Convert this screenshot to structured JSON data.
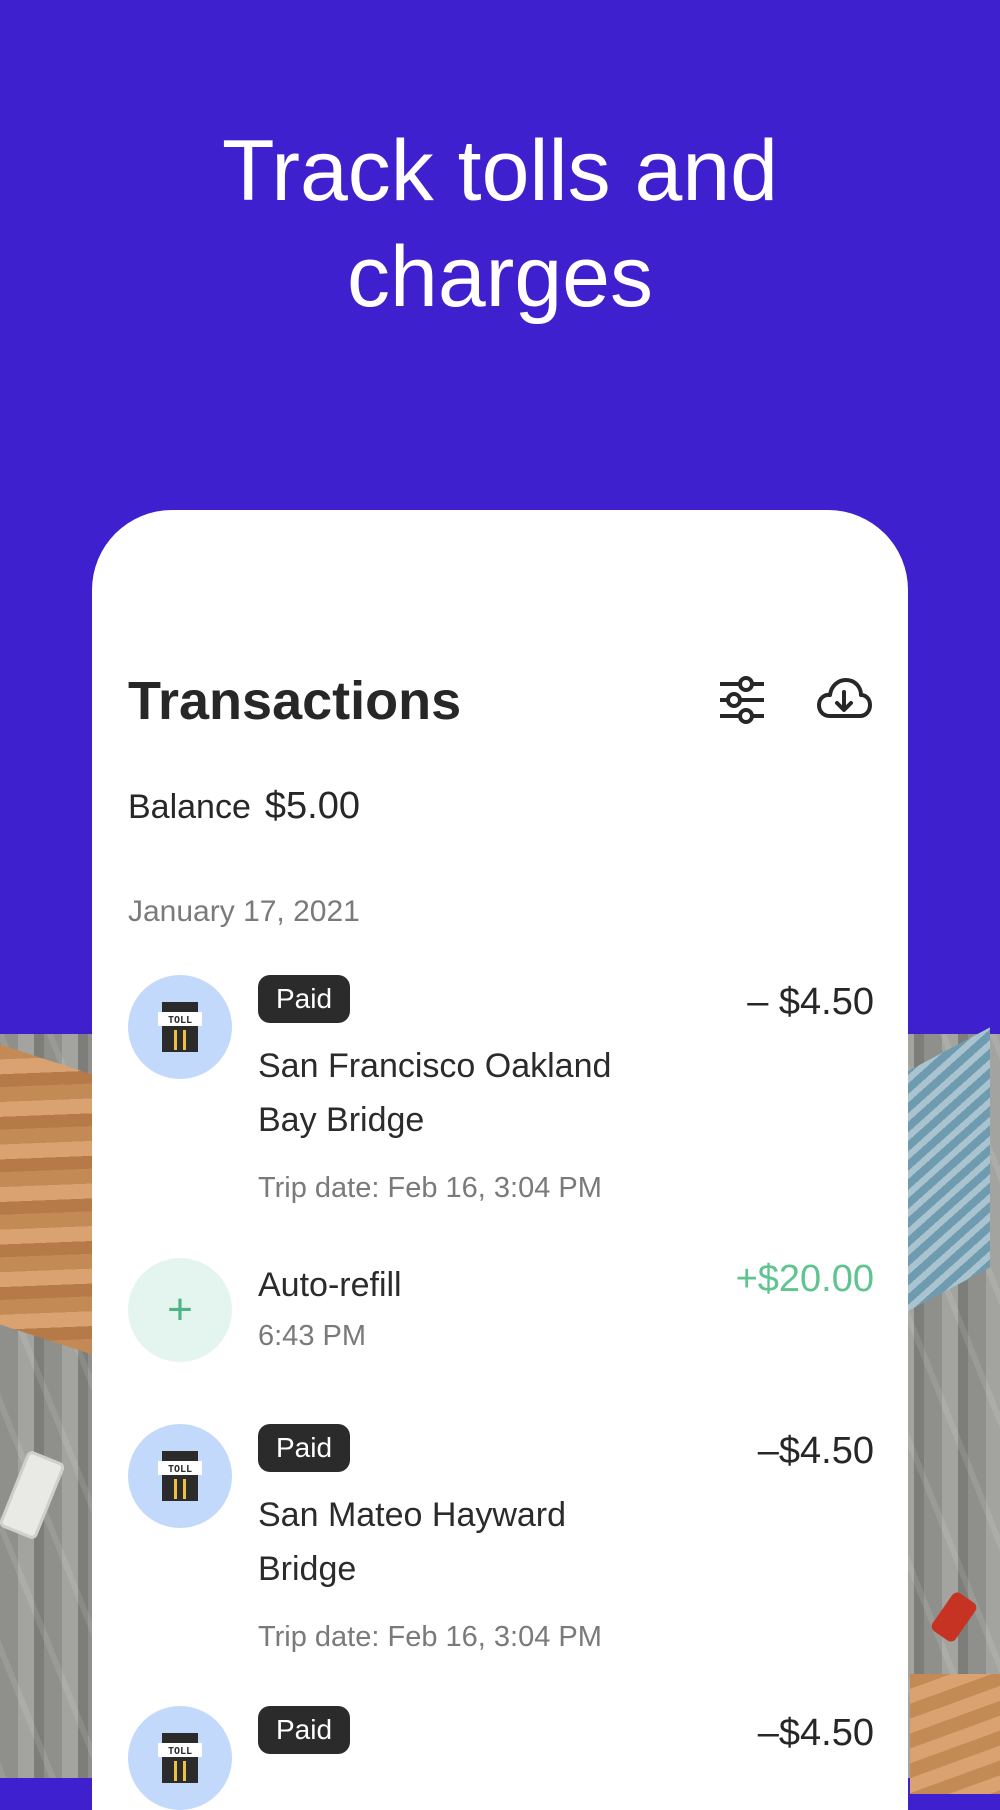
{
  "hero": {
    "title_line1": "Track tolls and",
    "title_line2": "charges"
  },
  "transactions": {
    "title": "Transactions",
    "filter_icon": "sliders-icon",
    "download_icon": "cloud-download-icon",
    "balance_label": "Balance",
    "balance_value": "$5.00",
    "date_header": "January 17, 2021",
    "items": [
      {
        "type": "toll",
        "badge": "Paid",
        "name": "San Francisco Oakland Bay Bridge",
        "sub": "Trip date: Feb 16, 3:04 PM",
        "amount": "– $4.50"
      },
      {
        "type": "refill",
        "icon": "+",
        "name": "Auto-refill",
        "sub": "6:43 PM",
        "amount": "+$20.00"
      },
      {
        "type": "toll",
        "badge": "Paid",
        "name": "San Mateo Hayward Bridge",
        "sub": "Trip date: Feb 16, 3:04 PM",
        "amount": "–$4.50"
      },
      {
        "type": "toll",
        "badge": "Paid",
        "name": "",
        "sub": "",
        "amount": "–$4.50"
      }
    ],
    "toll_sign_text": "TOLL"
  },
  "colors": {
    "brand_purple": "#3e20cf",
    "positive_green": "#5fc48f",
    "toll_icon_bg": "#c2d9fb",
    "refill_icon_bg": "#e3f5ee"
  }
}
